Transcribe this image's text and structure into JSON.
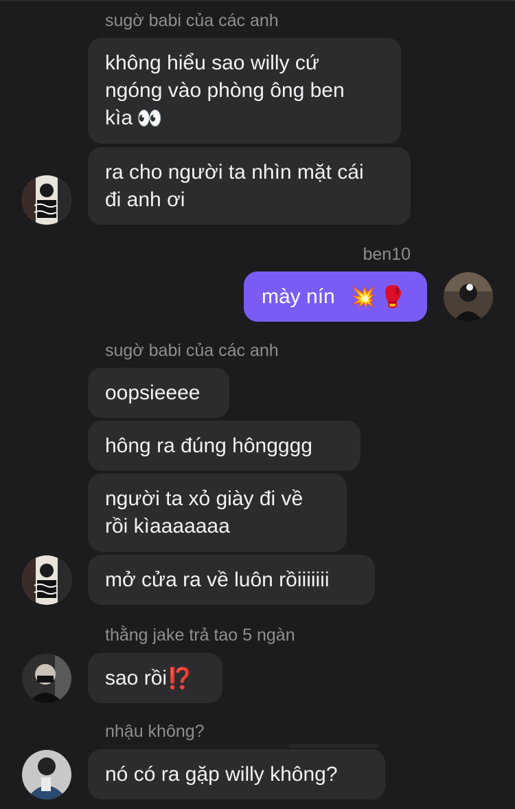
{
  "chat": {
    "groups": [
      {
        "sender": "sugờ babi của các anh",
        "messages": [
          "không hiểu sao willy cứ\nngóng vào phòng ông ben\nkìa",
          "ra cho người ta nhìn mặt cái\nđi anh ơi"
        ],
        "emoji_first": "👀"
      },
      {
        "sender": "ben10",
        "messages": [
          "mày nín"
        ],
        "emoji_mine": [
          "💥",
          "🥊"
        ]
      },
      {
        "sender": "sugờ babi của các anh",
        "messages": [
          "oopsieeee",
          "hông ra đúng hôngggg",
          "người ta xỏ giày đi về\nrồi kìaaaaaaa",
          "mở cửa ra về luôn rồiiiiiii"
        ]
      },
      {
        "sender": "thằng jake trả tao 5 ngàn",
        "messages": [
          "sao rồi"
        ],
        "emoji_q": "⁉️"
      },
      {
        "sender": "nhậu không?",
        "messages": [
          "nó có ra gặp willy không?"
        ]
      }
    ]
  },
  "colors": {
    "background": "#1c1c1e",
    "incoming_bubble": "#2c2c2e",
    "outgoing_bubble": "#7a5cf5",
    "sender_text": "#8e8e93",
    "message_text": "#f2f2f7"
  },
  "icons": {
    "eyes": "eyes-emoji",
    "collision": "collision-emoji",
    "boxing": "boxing-glove-emoji",
    "interrobang": "exclamation-question-emoji"
  }
}
